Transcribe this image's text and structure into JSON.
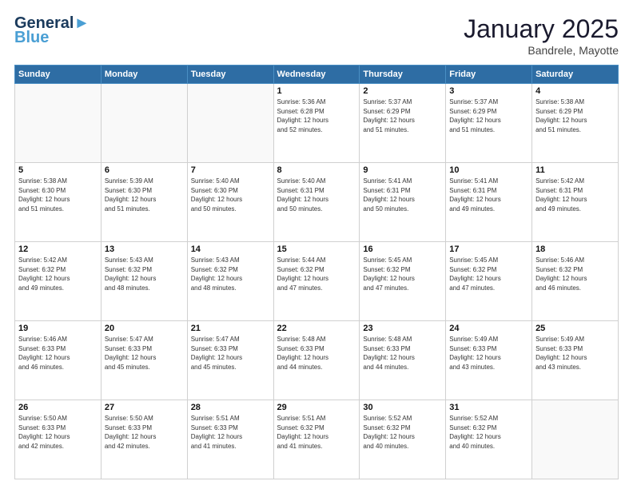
{
  "header": {
    "logo_line1": "General",
    "logo_line2": "Blue",
    "month": "January 2025",
    "location": "Bandrele, Mayotte"
  },
  "days_of_week": [
    "Sunday",
    "Monday",
    "Tuesday",
    "Wednesday",
    "Thursday",
    "Friday",
    "Saturday"
  ],
  "weeks": [
    [
      {
        "num": "",
        "info": ""
      },
      {
        "num": "",
        "info": ""
      },
      {
        "num": "",
        "info": ""
      },
      {
        "num": "1",
        "info": "Sunrise: 5:36 AM\nSunset: 6:28 PM\nDaylight: 12 hours\nand 52 minutes."
      },
      {
        "num": "2",
        "info": "Sunrise: 5:37 AM\nSunset: 6:29 PM\nDaylight: 12 hours\nand 51 minutes."
      },
      {
        "num": "3",
        "info": "Sunrise: 5:37 AM\nSunset: 6:29 PM\nDaylight: 12 hours\nand 51 minutes."
      },
      {
        "num": "4",
        "info": "Sunrise: 5:38 AM\nSunset: 6:29 PM\nDaylight: 12 hours\nand 51 minutes."
      }
    ],
    [
      {
        "num": "5",
        "info": "Sunrise: 5:38 AM\nSunset: 6:30 PM\nDaylight: 12 hours\nand 51 minutes."
      },
      {
        "num": "6",
        "info": "Sunrise: 5:39 AM\nSunset: 6:30 PM\nDaylight: 12 hours\nand 51 minutes."
      },
      {
        "num": "7",
        "info": "Sunrise: 5:40 AM\nSunset: 6:30 PM\nDaylight: 12 hours\nand 50 minutes."
      },
      {
        "num": "8",
        "info": "Sunrise: 5:40 AM\nSunset: 6:31 PM\nDaylight: 12 hours\nand 50 minutes."
      },
      {
        "num": "9",
        "info": "Sunrise: 5:41 AM\nSunset: 6:31 PM\nDaylight: 12 hours\nand 50 minutes."
      },
      {
        "num": "10",
        "info": "Sunrise: 5:41 AM\nSunset: 6:31 PM\nDaylight: 12 hours\nand 49 minutes."
      },
      {
        "num": "11",
        "info": "Sunrise: 5:42 AM\nSunset: 6:31 PM\nDaylight: 12 hours\nand 49 minutes."
      }
    ],
    [
      {
        "num": "12",
        "info": "Sunrise: 5:42 AM\nSunset: 6:32 PM\nDaylight: 12 hours\nand 49 minutes."
      },
      {
        "num": "13",
        "info": "Sunrise: 5:43 AM\nSunset: 6:32 PM\nDaylight: 12 hours\nand 48 minutes."
      },
      {
        "num": "14",
        "info": "Sunrise: 5:43 AM\nSunset: 6:32 PM\nDaylight: 12 hours\nand 48 minutes."
      },
      {
        "num": "15",
        "info": "Sunrise: 5:44 AM\nSunset: 6:32 PM\nDaylight: 12 hours\nand 47 minutes."
      },
      {
        "num": "16",
        "info": "Sunrise: 5:45 AM\nSunset: 6:32 PM\nDaylight: 12 hours\nand 47 minutes."
      },
      {
        "num": "17",
        "info": "Sunrise: 5:45 AM\nSunset: 6:32 PM\nDaylight: 12 hours\nand 47 minutes."
      },
      {
        "num": "18",
        "info": "Sunrise: 5:46 AM\nSunset: 6:32 PM\nDaylight: 12 hours\nand 46 minutes."
      }
    ],
    [
      {
        "num": "19",
        "info": "Sunrise: 5:46 AM\nSunset: 6:33 PM\nDaylight: 12 hours\nand 46 minutes."
      },
      {
        "num": "20",
        "info": "Sunrise: 5:47 AM\nSunset: 6:33 PM\nDaylight: 12 hours\nand 45 minutes."
      },
      {
        "num": "21",
        "info": "Sunrise: 5:47 AM\nSunset: 6:33 PM\nDaylight: 12 hours\nand 45 minutes."
      },
      {
        "num": "22",
        "info": "Sunrise: 5:48 AM\nSunset: 6:33 PM\nDaylight: 12 hours\nand 44 minutes."
      },
      {
        "num": "23",
        "info": "Sunrise: 5:48 AM\nSunset: 6:33 PM\nDaylight: 12 hours\nand 44 minutes."
      },
      {
        "num": "24",
        "info": "Sunrise: 5:49 AM\nSunset: 6:33 PM\nDaylight: 12 hours\nand 43 minutes."
      },
      {
        "num": "25",
        "info": "Sunrise: 5:49 AM\nSunset: 6:33 PM\nDaylight: 12 hours\nand 43 minutes."
      }
    ],
    [
      {
        "num": "26",
        "info": "Sunrise: 5:50 AM\nSunset: 6:33 PM\nDaylight: 12 hours\nand 42 minutes."
      },
      {
        "num": "27",
        "info": "Sunrise: 5:50 AM\nSunset: 6:33 PM\nDaylight: 12 hours\nand 42 minutes."
      },
      {
        "num": "28",
        "info": "Sunrise: 5:51 AM\nSunset: 6:33 PM\nDaylight: 12 hours\nand 41 minutes."
      },
      {
        "num": "29",
        "info": "Sunrise: 5:51 AM\nSunset: 6:32 PM\nDaylight: 12 hours\nand 41 minutes."
      },
      {
        "num": "30",
        "info": "Sunrise: 5:52 AM\nSunset: 6:32 PM\nDaylight: 12 hours\nand 40 minutes."
      },
      {
        "num": "31",
        "info": "Sunrise: 5:52 AM\nSunset: 6:32 PM\nDaylight: 12 hours\nand 40 minutes."
      },
      {
        "num": "",
        "info": ""
      }
    ]
  ]
}
